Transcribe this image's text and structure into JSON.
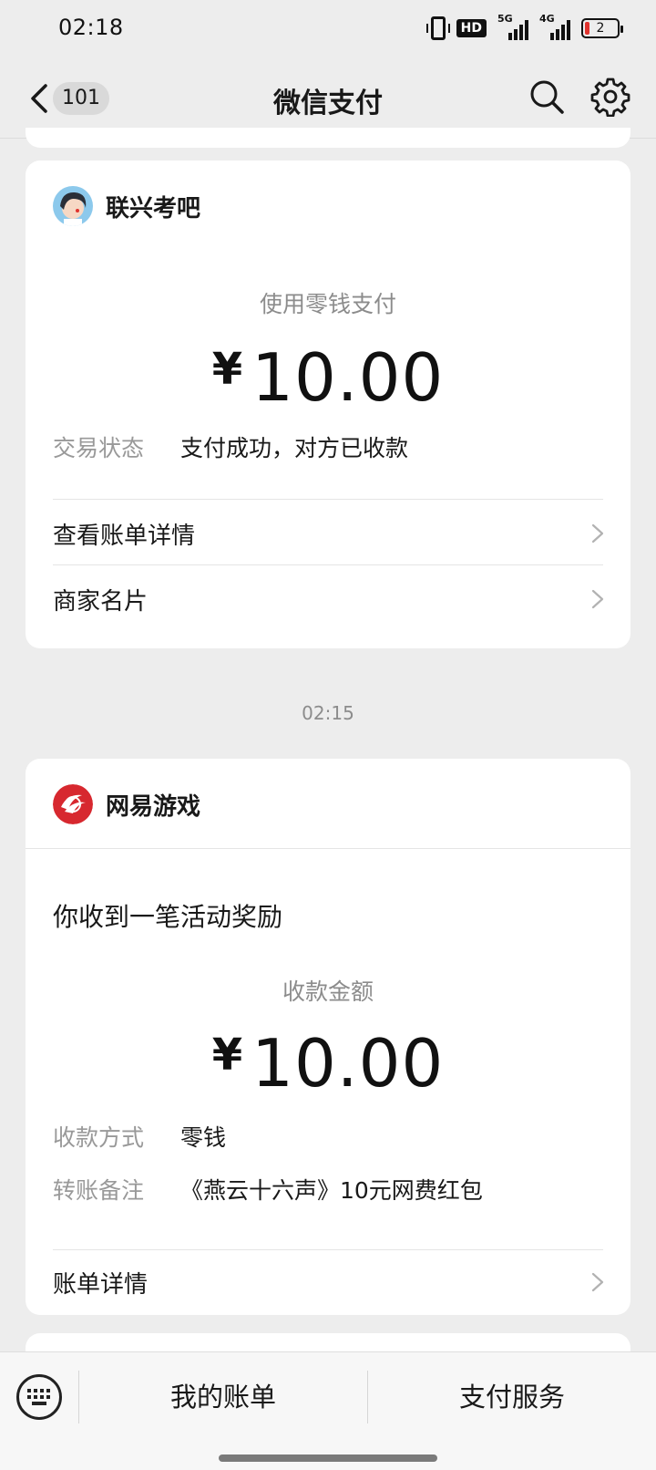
{
  "status_bar": {
    "time": "02:18",
    "hd": "HD",
    "sim1": "5G",
    "sim2": "4G",
    "battery": "2"
  },
  "nav": {
    "unread_count": "101",
    "title": "微信支付"
  },
  "card1": {
    "merchant": "联兴考吧",
    "pay_method": "使用零钱支付",
    "currency": "¥",
    "amount": "10.00",
    "status_key": "交易状态",
    "status_value": "支付成功，对方已收款",
    "row1": "查看账单详情",
    "row2": "商家名片"
  },
  "time_separator": "02:15",
  "card2": {
    "merchant": "网易游戏",
    "headline": "你收到一笔活动奖励",
    "amount_label": "收款金额",
    "currency": "¥",
    "amount": "10.00",
    "method_key": "收款方式",
    "method_value": "零钱",
    "note_key": "转账备注",
    "note_value": "《燕云十六声》10元网费红包",
    "row1": "账单详情"
  },
  "bottom_bar": {
    "tab1": "我的账单",
    "tab2": "支付服务"
  }
}
